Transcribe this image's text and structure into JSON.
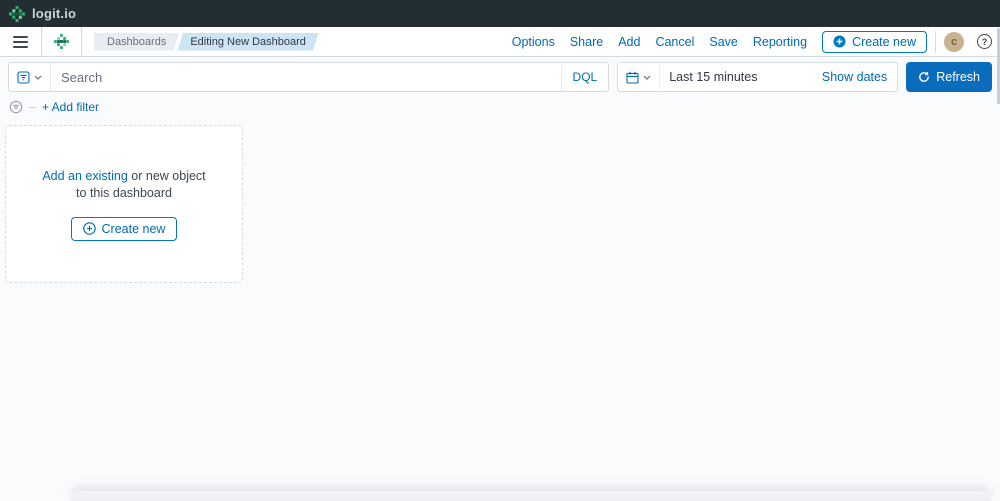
{
  "brand": {
    "logo_text": "logit.io"
  },
  "toolbar": {
    "breadcrumbs": {
      "first": "Dashboards",
      "current": "Editing New Dashboard"
    },
    "links": {
      "options": "Options",
      "share": "Share",
      "add": "Add",
      "cancel": "Cancel",
      "save": "Save",
      "reporting": "Reporting"
    },
    "create_new_label": "Create new",
    "avatar_initial": "c",
    "help_glyph": "?"
  },
  "querybar": {
    "search_placeholder": "Search",
    "language": "DQL",
    "time_range": "Last 15 minutes",
    "show_dates": "Show dates",
    "refresh": "Refresh"
  },
  "filterbar": {
    "add_filter": "+ Add filter"
  },
  "empty_panel": {
    "line1_link": "Add an existing",
    "line1_rest": " or new object",
    "line2": "to this dashboard",
    "create_new": "Create new"
  },
  "icons": {
    "brand": "logit-pixel-asterisk-icon",
    "menu": "hamburger-menu-icon",
    "saved_query": "filter-square-icon",
    "chevron": "chevron-down-icon",
    "calendar": "calendar-icon",
    "refresh": "refresh-cycle-icon",
    "help": "question-circle-icon",
    "filter_options": "filter-circle-icon",
    "plus_filled": "plus-circle-filled-icon",
    "plus_outline": "plus-circle-outline-icon"
  },
  "colors": {
    "accent_blue": "#006bb4",
    "button_blue": "#0a6cbd",
    "brand_green": "#2fae70",
    "header_bg": "#232e33",
    "border_gray": "#d3dae6",
    "chip_gray": "#e9edf3",
    "chip_blue": "#cde4f5",
    "avatar_tan": "#c9b28e",
    "page_bg": "#fafbfd"
  }
}
